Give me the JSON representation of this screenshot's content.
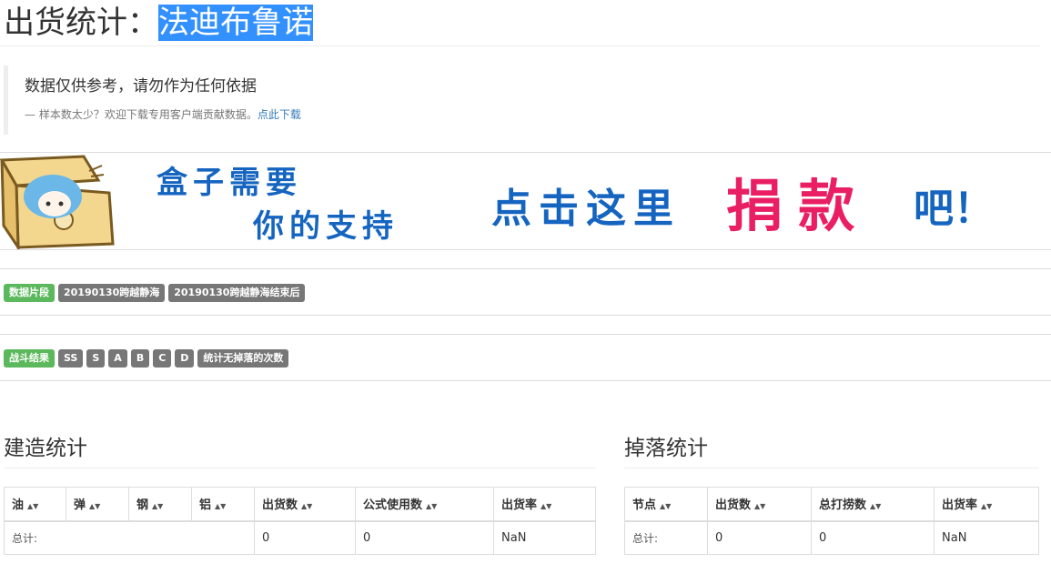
{
  "page": {
    "title_prefix": "出货统计：",
    "title_ship": "法迪布鲁诺"
  },
  "notice": {
    "main": "数据仅供参考，请勿作为任何依据",
    "sub_prefix": "— 样本数太少？欢迎下载专用客户端贡献数据。",
    "download_link": "点此下载"
  },
  "banner": {
    "line1": "盒子需要",
    "line2": "你的支持",
    "cta_prefix": "点击这里",
    "cta_emph": "捐 款",
    "cta_suffix": "吧！",
    "colors": {
      "blue": "#1565c0",
      "pink": "#e91e63",
      "chest": "#f3d78f",
      "hair": "#6ab7e8"
    }
  },
  "filters": {
    "period": {
      "label": "数据片段",
      "options": [
        "20190130跨越静海",
        "20190130跨越静海结束后"
      ]
    },
    "result": {
      "label": "战斗结果",
      "options": [
        "SS",
        "S",
        "A",
        "B",
        "C",
        "D",
        "统计无掉落的次数"
      ]
    }
  },
  "build": {
    "title": "建造统计",
    "headers": [
      "油",
      "弹",
      "钢",
      "铝",
      "出货数",
      "公式使用数",
      "出货率"
    ],
    "total_label": "总计:",
    "total_values": [
      "0",
      "0",
      "NaN"
    ]
  },
  "drop": {
    "title": "掉落统计",
    "headers": [
      "节点",
      "出货数",
      "总打捞数",
      "出货率"
    ],
    "total_label": "总计:",
    "total_values": [
      "0",
      "0",
      "NaN"
    ]
  },
  "colors": {
    "label_success": "#5cb85c",
    "label_default": "#777777",
    "link": "#337ab7",
    "selection": "#3390ff"
  }
}
